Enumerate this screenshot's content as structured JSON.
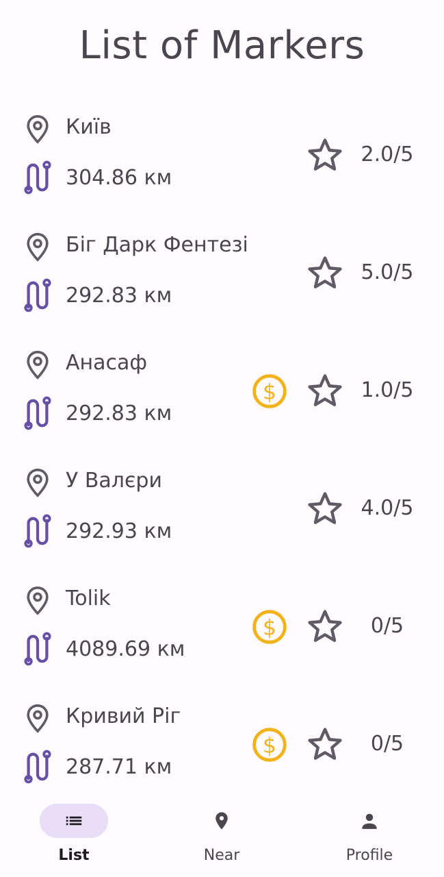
{
  "header": {
    "title": "List of Markers"
  },
  "markers": [
    {
      "name": "Київ",
      "distance": "304.86 км",
      "paid": false,
      "rating": "2.0/5"
    },
    {
      "name": "Біг Дарк Фентезі",
      "distance": "292.83 км",
      "paid": false,
      "rating": "5.0/5"
    },
    {
      "name": "Анасаф",
      "distance": "292.83 км",
      "paid": true,
      "rating": "1.0/5"
    },
    {
      "name": "У Валєри",
      "distance": "292.93 км",
      "paid": false,
      "rating": "4.0/5"
    },
    {
      "name": "Tolik",
      "distance": "4089.69 км",
      "paid": true,
      "rating": "0/5"
    },
    {
      "name": "Кривий Ріг",
      "distance": "287.71 км",
      "paid": true,
      "rating": "0/5"
    }
  ],
  "nav": {
    "items": [
      {
        "label": "List",
        "icon": "list-icon",
        "active": true
      },
      {
        "label": "Near",
        "icon": "location-pin-icon",
        "active": false
      },
      {
        "label": "Profile",
        "icon": "person-icon",
        "active": false
      }
    ]
  },
  "colors": {
    "background": "#fffbfe",
    "text": "#4a4650",
    "route_icon": "#6750a4",
    "coin_icon": "#f2b21a",
    "nav_active_pill": "#e8def8"
  }
}
